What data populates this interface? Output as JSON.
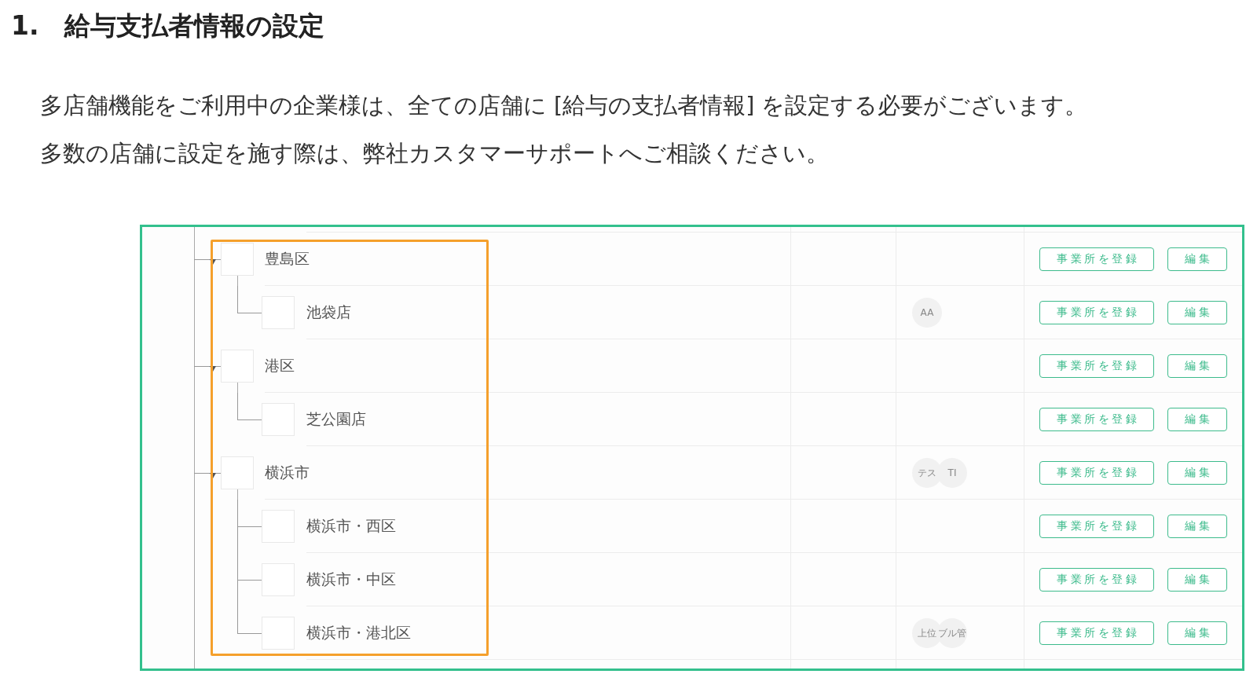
{
  "heading": "1.　給与支払者情報の設定",
  "paragraphs": [
    "多店舗機能をご利用中の企業様は、全ての店舗に [給与の支払者情報] を設定する必要がございます。",
    "多数の店舗に設定を施す際は、弊社カスタマーサポートへご相談ください。"
  ],
  "screenshot": {
    "tree": [
      {
        "label": "豊島区",
        "buttons": [
          "事業所を登録",
          "編集"
        ],
        "children": [
          {
            "label": "池袋店",
            "avatars": [
              "AA"
            ],
            "buttons": [
              "事業所を登録",
              "編集"
            ]
          }
        ]
      },
      {
        "label": "港区",
        "buttons": [
          "事業所を登録",
          "編集"
        ],
        "children": [
          {
            "label": "芝公園店",
            "buttons": [
              "事業所を登録",
              "編集"
            ]
          }
        ]
      },
      {
        "label": "横浜市",
        "avatars": [
          "テス",
          "TI"
        ],
        "buttons": [
          "事業所を登録",
          "編集"
        ],
        "children": [
          {
            "label": "横浜市・西区",
            "buttons": [
              "事業所を登録",
              "編集"
            ]
          },
          {
            "label": "横浜市・中区",
            "buttons": [
              "事業所を登録",
              "編集"
            ]
          },
          {
            "label": "横浜市・港北区",
            "avatars": [
              "上位",
              "ブル管"
            ],
            "buttons": [
              "事業所を登録",
              "編集"
            ]
          }
        ]
      }
    ]
  }
}
